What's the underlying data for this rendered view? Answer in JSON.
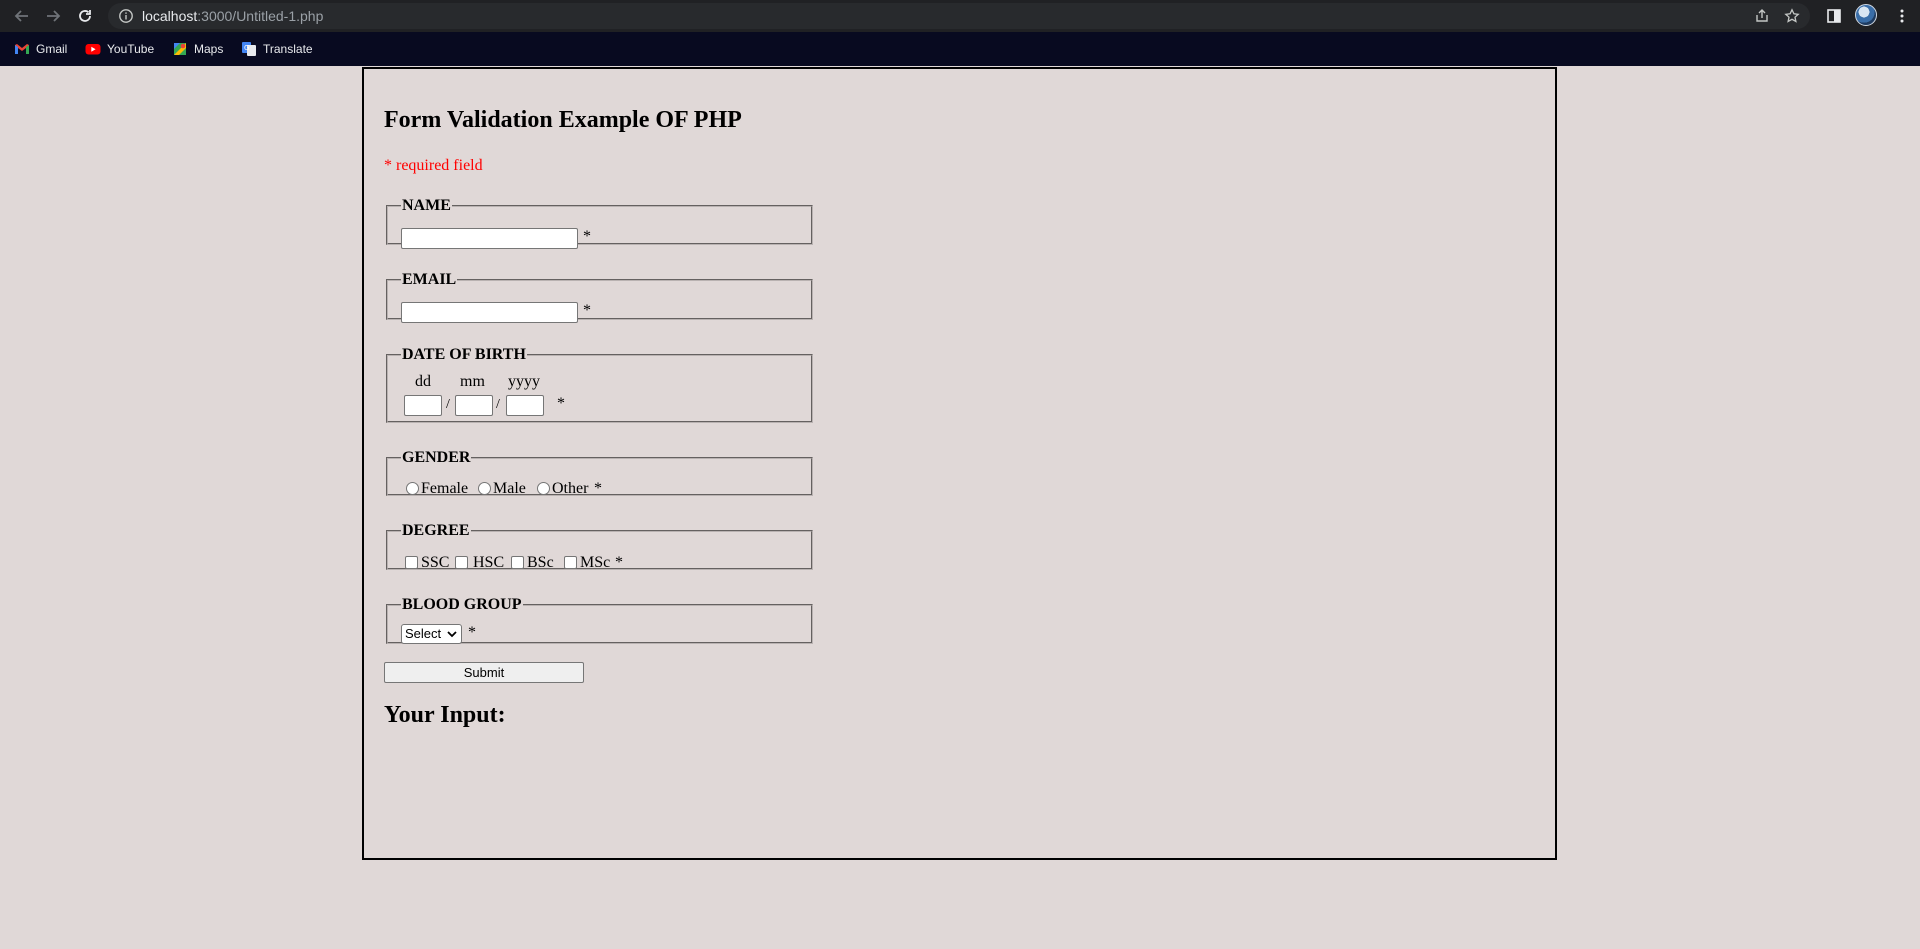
{
  "browser": {
    "url_host": "localhost",
    "url_rest": ":3000/Untitled-1.php",
    "bookmarks": [
      {
        "label": "Gmail",
        "icon": "gmail-icon"
      },
      {
        "label": "YouTube",
        "icon": "youtube-icon"
      },
      {
        "label": "Maps",
        "icon": "maps-icon"
      },
      {
        "label": "Translate",
        "icon": "translate-icon"
      }
    ]
  },
  "page": {
    "title": "Form Validation Example OF PHP",
    "required_note": "* required field",
    "required_star": "*",
    "name": {
      "legend": "NAME",
      "value": ""
    },
    "email": {
      "legend": "EMAIL",
      "value": ""
    },
    "dob": {
      "legend": "DATE OF BIRTH",
      "dd_label": "dd",
      "mm_label": "mm",
      "yyyy_label": "yyyy",
      "separator": "/"
    },
    "gender": {
      "legend": "GENDER",
      "options": [
        "Female",
        "Male",
        "Other"
      ]
    },
    "degree": {
      "legend": "DEGREE",
      "options": [
        "SSC",
        "HSC",
        "BSc",
        "MSc"
      ]
    },
    "blood_group": {
      "legend": "BLOOD GROUP",
      "selected": "Select"
    },
    "submit_label": "Submit",
    "your_input_heading": "Your Input:"
  },
  "colors": {
    "background": "#e0d8d7",
    "required": "#ff0000",
    "tab_bar": "#202124",
    "bookmarks_bar": "#080a20"
  }
}
